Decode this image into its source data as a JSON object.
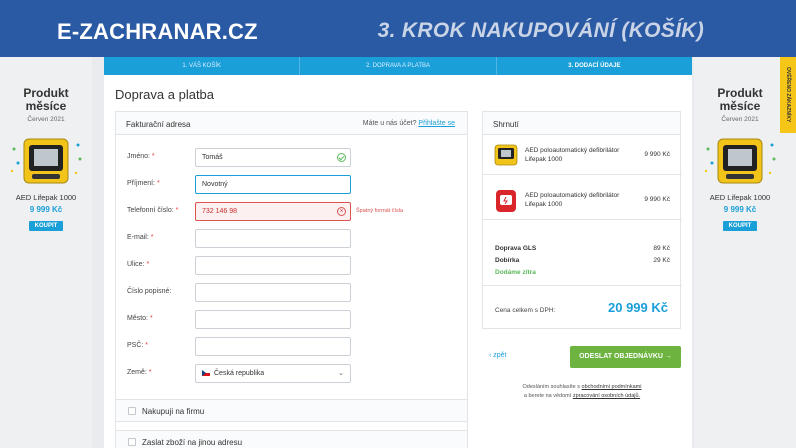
{
  "banner": {
    "brand": "E-ZACHRANAR.CZ",
    "title": "3. KROK NAKUPOVÁNÍ (KOŠÍK)"
  },
  "steps": [
    {
      "label": "1. VÁŠ KOŠÍK",
      "active": false
    },
    {
      "label": "2. DOPRAVA A PLATBA",
      "active": false
    },
    {
      "label": "3. DODACÍ ÚDAJE",
      "active": true
    }
  ],
  "page_title": "Doprava a platba",
  "promo": {
    "title_line1": "Produkt",
    "title_line2": "měsíce",
    "date": "Červen 2021",
    "name": "AED Lifepak 1000",
    "price": "9 999 Kč",
    "buy": "KOUPIT"
  },
  "side_tab": "OVĚŘENO ZÁKAZNÍKY",
  "billing": {
    "title": "Fakturační adresa",
    "login_prompt": "Máte u nás účet?",
    "login_link": "Přihlašte se",
    "fields": [
      {
        "label": "Jméno:",
        "value": "Tomáš",
        "state": "ok"
      },
      {
        "label": "Příjmení:",
        "value": "Novotný",
        "state": "focus"
      },
      {
        "label": "Telefonní číslo:",
        "value": "732 146 98",
        "state": "error",
        "error": "Špatný formát čísla"
      },
      {
        "label": "E-mail:",
        "value": "",
        "state": "empty"
      },
      {
        "label": "Ulice:",
        "value": "",
        "state": "empty"
      },
      {
        "label": "Číslo popisné:",
        "value": "",
        "state": "empty"
      },
      {
        "label": "Město:",
        "value": "",
        "state": "empty"
      },
      {
        "label": "PSČ:",
        "value": "",
        "state": "empty"
      },
      {
        "label": "Země:",
        "value": "Česká republika",
        "state": "select"
      }
    ],
    "required_mark": "*"
  },
  "options": {
    "company": "Nakupuji na firmu",
    "other_address": "Zaslat zboží na jinou adresu"
  },
  "summary": {
    "title": "Shrnutí",
    "items": [
      {
        "name": "AED poloautomatický defibrilátor Lifepak 1000",
        "price": "9 990 Kč"
      },
      {
        "name": "AED poloautomatický defibrilátor Lifepak 1000",
        "price": "9 990 Kč"
      }
    ],
    "shipping_label": "Doprava GLS",
    "shipping_price": "89 Kč",
    "cod_label": "Dobírka",
    "cod_price": "29 Kč",
    "delivery_note": "Dodáme zítra",
    "total_label": "Cena celkem s DPH:",
    "total_value": "20 999 Kč"
  },
  "actions": {
    "back": "‹ zpět",
    "submit": "ODESLAT OBJEDNÁVKU  →"
  },
  "consent": {
    "line1_prefix": "Odesláním souhlasíte s ",
    "terms_link": "obchodními podmínkami",
    "line2_prefix": "a berete na vědomí ",
    "privacy_link": "zpracování osobních údajů."
  },
  "colors": {
    "banner": "#2b5aa5",
    "accent": "#1a9fd8",
    "submit": "#6cb33f",
    "error": "#d9534f"
  }
}
